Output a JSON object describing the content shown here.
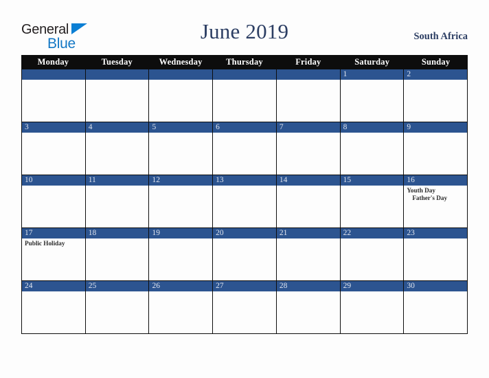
{
  "branding": {
    "logo_word_1": "General",
    "logo_word_2": "Blue",
    "logo_accent_color": "#1277c4"
  },
  "header": {
    "title": "June 2019",
    "country": "South Africa",
    "title_color": "#2c3e63"
  },
  "calendar": {
    "header_bg": "#0d0d0d",
    "daynum_bg": "#2c5490",
    "weekdays": [
      "Monday",
      "Tuesday",
      "Wednesday",
      "Thursday",
      "Friday",
      "Saturday",
      "Sunday"
    ],
    "weeks": [
      [
        {
          "day": "",
          "events": []
        },
        {
          "day": "",
          "events": []
        },
        {
          "day": "",
          "events": []
        },
        {
          "day": "",
          "events": []
        },
        {
          "day": "",
          "events": []
        },
        {
          "day": "1",
          "events": []
        },
        {
          "day": "2",
          "events": []
        }
      ],
      [
        {
          "day": "3",
          "events": []
        },
        {
          "day": "4",
          "events": []
        },
        {
          "day": "5",
          "events": []
        },
        {
          "day": "6",
          "events": []
        },
        {
          "day": "7",
          "events": []
        },
        {
          "day": "8",
          "events": []
        },
        {
          "day": "9",
          "events": []
        }
      ],
      [
        {
          "day": "10",
          "events": []
        },
        {
          "day": "11",
          "events": []
        },
        {
          "day": "12",
          "events": []
        },
        {
          "day": "13",
          "events": []
        },
        {
          "day": "14",
          "events": []
        },
        {
          "day": "15",
          "events": []
        },
        {
          "day": "16",
          "events": [
            "Youth Day",
            "Father's Day"
          ]
        }
      ],
      [
        {
          "day": "17",
          "events": [
            "Public Holiday"
          ]
        },
        {
          "day": "18",
          "events": []
        },
        {
          "day": "19",
          "events": []
        },
        {
          "day": "20",
          "events": []
        },
        {
          "day": "21",
          "events": []
        },
        {
          "day": "22",
          "events": []
        },
        {
          "day": "23",
          "events": []
        }
      ],
      [
        {
          "day": "24",
          "events": []
        },
        {
          "day": "25",
          "events": []
        },
        {
          "day": "26",
          "events": []
        },
        {
          "day": "27",
          "events": []
        },
        {
          "day": "28",
          "events": []
        },
        {
          "day": "29",
          "events": []
        },
        {
          "day": "30",
          "events": []
        }
      ]
    ]
  }
}
